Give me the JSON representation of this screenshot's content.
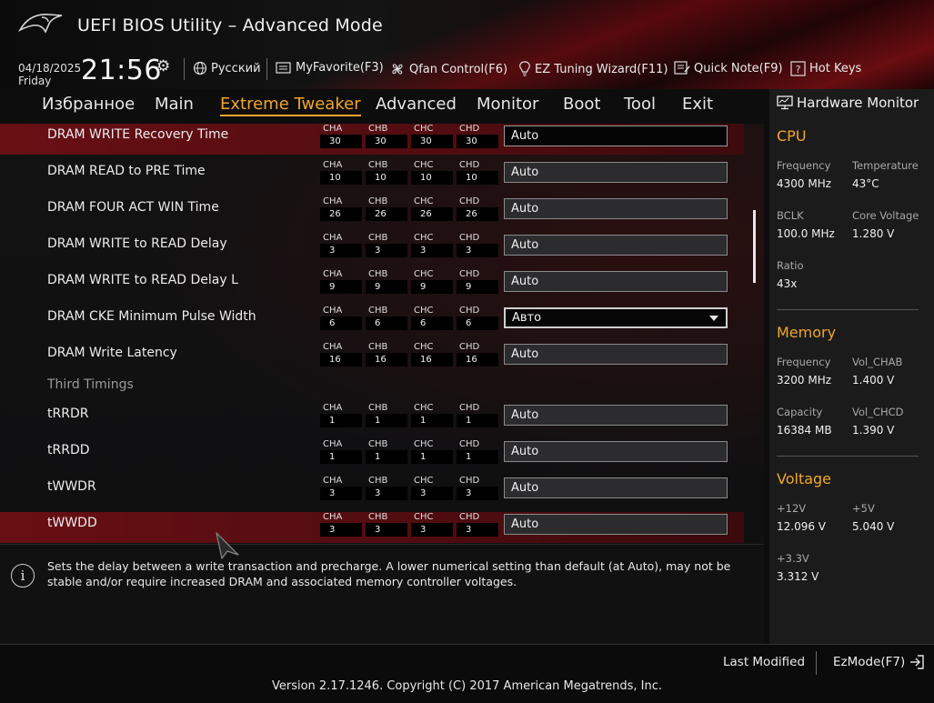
{
  "header": {
    "title": "UEFI BIOS Utility – Advanced Mode",
    "date": "04/18/2025",
    "day": "Friday",
    "time": "21:56",
    "toolbar": [
      {
        "icon": "globe-icon",
        "label": "Русский"
      },
      {
        "icon": "favorites-icon",
        "label": "MyFavorite(F3)"
      },
      {
        "icon": "fan-icon",
        "label": "Qfan Control(F6)"
      },
      {
        "icon": "lightbulb-icon",
        "label": "EZ Tuning Wizard(F11)"
      },
      {
        "icon": "note-icon",
        "label": "Quick Note(F9)"
      },
      {
        "icon": "question-icon",
        "label": "Hot Keys"
      }
    ]
  },
  "nav": {
    "tabs": [
      "Избранное",
      "Main",
      "Extreme Tweaker",
      "Advanced",
      "Monitor",
      "Boot",
      "Tool",
      "Exit"
    ],
    "active": "Extreme Tweaker"
  },
  "channel_labels": [
    "CHA",
    "CHB",
    "CHC",
    "CHD"
  ],
  "rows": [
    {
      "name": "DRAM WRITE Recovery Time",
      "ch": [
        "30",
        "30",
        "30",
        "30"
      ],
      "value": "Auto"
    },
    {
      "name": "DRAM READ to PRE Time",
      "ch": [
        "10",
        "10",
        "10",
        "10"
      ],
      "value": "Auto"
    },
    {
      "name": "DRAM FOUR ACT WIN Time",
      "ch": [
        "26",
        "26",
        "26",
        "26"
      ],
      "value": "Auto"
    },
    {
      "name": "DRAM WRITE to READ Delay",
      "ch": [
        "3",
        "3",
        "3",
        "3"
      ],
      "value": "Auto"
    },
    {
      "name": "DRAM WRITE to READ Delay L",
      "ch": [
        "9",
        "9",
        "9",
        "9"
      ],
      "value": "Auto"
    },
    {
      "name": "DRAM CKE Minimum Pulse Width",
      "ch": [
        "6",
        "6",
        "6",
        "6"
      ],
      "value": "Авто"
    },
    {
      "name": "DRAM Write Latency",
      "ch": [
        "16",
        "16",
        "16",
        "16"
      ],
      "value": "Auto"
    },
    {
      "name": "tRRDR",
      "ch": [
        "1",
        "1",
        "1",
        "1"
      ],
      "value": "Auto"
    },
    {
      "name": "tRRDD",
      "ch": [
        "1",
        "1",
        "1",
        "1"
      ],
      "value": "Auto"
    },
    {
      "name": "tWWDR",
      "ch": [
        "3",
        "3",
        "3",
        "3"
      ],
      "value": "Auto"
    },
    {
      "name": "tWWDD",
      "ch": [
        "3",
        "3",
        "3",
        "3"
      ],
      "value": "Auto"
    }
  ],
  "section_third_timings": "Third Timings",
  "description": "Sets the delay between a write transaction and precharge. A lower numerical setting than default (at Auto), may not be stable and/or require increased DRAM and associated memory controller voltages.",
  "hw_monitor": {
    "title": "Hardware Monitor",
    "cpu": {
      "label": "CPU",
      "frequency_label": "Frequency",
      "frequency": "4300 MHz",
      "temperature_label": "Temperature",
      "temperature": "43°C",
      "bclk_label": "BCLK",
      "bclk": "100.0 MHz",
      "core_voltage_label": "Core Voltage",
      "core_voltage": "1.280 V",
      "ratio_label": "Ratio",
      "ratio": "43x"
    },
    "memory": {
      "label": "Memory",
      "frequency_label": "Frequency",
      "frequency": "3200 MHz",
      "vol_chab_label": "Vol_CHAB",
      "vol_chab": "1.400 V",
      "capacity_label": "Capacity",
      "capacity": "16384 MB",
      "vol_chcd_label": "Vol_CHCD",
      "vol_chcd": "1.390 V"
    },
    "voltage": {
      "label": "Voltage",
      "v12_label": "+12V",
      "v12": "12.096 V",
      "v5_label": "+5V",
      "v5": "5.040 V",
      "v33_label": "+3.3V",
      "v33": "3.312 V"
    }
  },
  "footer": {
    "last_modified": "Last Modified",
    "ezmode": "EzMode(F7)",
    "version": "Version 2.17.1246. Copyright (C) 2017 American Megatrends, Inc."
  },
  "colors": {
    "accent": "#f0a62a",
    "highlight_row": "#7a0f14"
  }
}
